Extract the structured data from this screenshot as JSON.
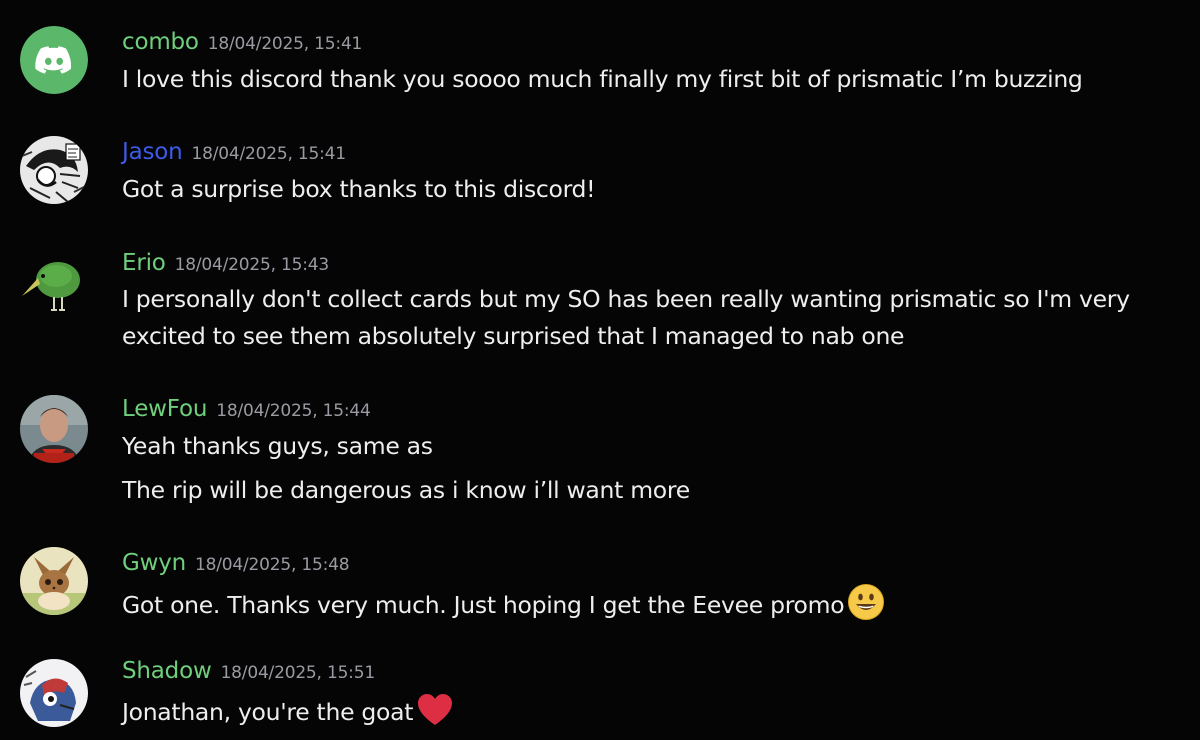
{
  "colors": {
    "background": "#050505",
    "username_green": "#6fcf7c",
    "username_blue": "#3d5be8",
    "timestamp": "#9a9ba2",
    "text": "#eeeeee"
  },
  "messages": [
    {
      "username": "combo",
      "username_color": "#6fcf7c",
      "timestamp": "18/04/2025, 15:41",
      "avatar": "discord-logo-avatar",
      "lines": [
        "I love this discord thank you soooo much finally my first bit of prismatic I’m buzzing"
      ]
    },
    {
      "username": "Jason",
      "username_color": "#3d5be8",
      "timestamp": "18/04/2025, 15:41",
      "avatar": "manga-sketch-avatar",
      "lines": [
        "Got a surprise box thanks to this discord!"
      ]
    },
    {
      "username": "Erio",
      "username_color": "#6fcf7c",
      "timestamp": "18/04/2025, 15:43",
      "avatar": "green-kiwi-bird-avatar",
      "lines": [
        "I personally don't collect cards but my SO has been really wanting prismatic so I'm very",
        "excited to see them absolutely surprised that I managed to nab one"
      ]
    },
    {
      "username": "LewFou",
      "username_color": "#6fcf7c",
      "timestamp": "18/04/2025, 15:44",
      "avatar": "photo-portrait-avatar",
      "lines": [
        "Yeah thanks guys, same as",
        "The rip will be dangerous as i know i’ll want more"
      ]
    },
    {
      "username": "Gwyn",
      "username_color": "#6fcf7c",
      "timestamp": "18/04/2025, 15:48",
      "avatar": "eevee-avatar",
      "lines": [
        "Got one. Thanks very much. Just hoping I get the Eevee promo"
      ],
      "emoji": "smiley-emoji"
    },
    {
      "username": "Shadow",
      "username_color": "#6fcf7c",
      "timestamp": "18/04/2025, 15:51",
      "avatar": "cartoon-character-avatar",
      "lines": [
        "Jonathan, you're the goat"
      ],
      "emoji": "red-heart-emoji"
    }
  ]
}
